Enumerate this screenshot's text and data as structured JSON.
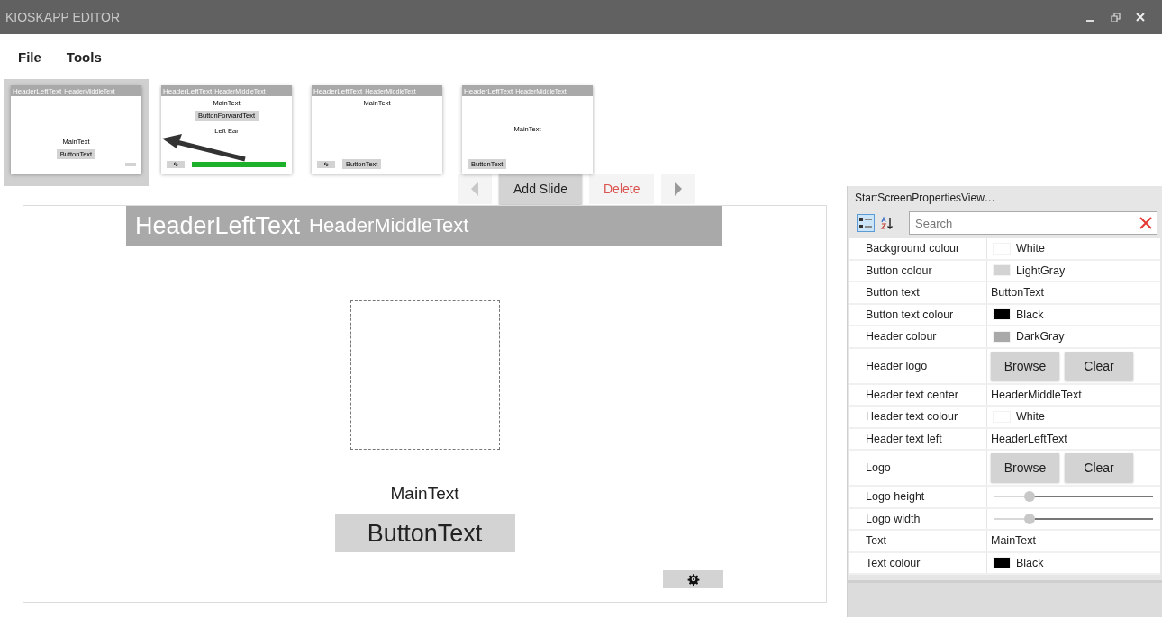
{
  "window": {
    "title": "KIOSKAPP EDITOR"
  },
  "menu": [
    "File",
    "Tools"
  ],
  "slides": [
    {
      "selected": true,
      "header_left": "HeaderLeftText",
      "header_middle": "HeaderMiddleText",
      "bottom": [
        {
          "kind": "text",
          "text": "MainText"
        },
        {
          "kind": "button",
          "text": "ButtonText"
        }
      ],
      "footer": [
        {
          "kind": "settings"
        }
      ]
    },
    {
      "selected": false,
      "header_left": "HeaderLeftText",
      "header_middle": "HeaderMiddleText",
      "top": [
        {
          "kind": "text",
          "text": "MainText"
        },
        {
          "kind": "button",
          "text": "ButtonForwardText"
        },
        {
          "kind": "text",
          "text": "Left Ear"
        }
      ],
      "footer": [
        {
          "kind": "back"
        },
        {
          "kind": "progress",
          "level": 1
        }
      ]
    },
    {
      "selected": false,
      "header_left": "HeaderLeftText",
      "header_middle": "HeaderMiddleText",
      "top": [
        {
          "kind": "text",
          "text": "MainText"
        }
      ],
      "footer": [
        {
          "kind": "back"
        },
        {
          "kind": "button",
          "text": "ButtonText"
        }
      ]
    },
    {
      "selected": false,
      "header_left": "HeaderLeftText",
      "header_middle": "HeaderMiddleText",
      "middle": [
        {
          "kind": "text",
          "text": "MainText"
        }
      ],
      "footer": [
        {
          "kind": "button",
          "text": "ButtonText"
        }
      ]
    }
  ],
  "slide_toolbar": [
    {
      "kind": "prev",
      "disabled": true
    },
    {
      "kind": "button",
      "label": "Add Slide",
      "disabled": false
    },
    {
      "kind": "button",
      "label": "Delete",
      "disabled": true
    },
    {
      "kind": "next",
      "disabled": false
    }
  ],
  "editor": {
    "header_left": "HeaderLeftText",
    "header_middle": "HeaderMiddleText",
    "main_text": "MainText",
    "button_text": "ButtonText"
  },
  "properties": {
    "title": "StartScreenPropertiesView…",
    "view_modes": [
      {
        "kind": "categorized",
        "selected": true
      },
      {
        "kind": "alphabetical",
        "selected": false
      }
    ],
    "search": {
      "placeholder": "Search"
    },
    "rows": [
      {
        "name": "Background colour",
        "kind": "color",
        "value": "White",
        "color": "#ffffff"
      },
      {
        "name": "Button colour",
        "kind": "color",
        "value": "LightGray",
        "color": "#d3d3d3"
      },
      {
        "name": "Button text",
        "kind": "text",
        "value": "ButtonText"
      },
      {
        "name": "Button text colour",
        "kind": "color",
        "value": "Black",
        "color": "#000000"
      },
      {
        "name": "Header colour",
        "kind": "color",
        "value": "DarkGray",
        "color": "#a9a9a9"
      },
      {
        "name": "Header logo",
        "kind": "buttons",
        "buttons": [
          "Browse",
          "Clear"
        ]
      },
      {
        "name": "Header text center",
        "kind": "text",
        "value": "HeaderMiddleText"
      },
      {
        "name": "Header text colour",
        "kind": "color",
        "value": "White",
        "color": "#ffffff"
      },
      {
        "name": "Header text left",
        "kind": "text",
        "value": "HeaderLeftText"
      },
      {
        "name": "Logo",
        "kind": "buttons",
        "buttons": [
          "Browse",
          "Clear"
        ]
      },
      {
        "name": "Logo height",
        "kind": "slider",
        "level": 0.2
      },
      {
        "name": "Logo width",
        "kind": "slider",
        "level": 0.2
      },
      {
        "name": "Text",
        "kind": "text",
        "value": "MainText"
      },
      {
        "name": "Text colour",
        "kind": "color",
        "value": "Black",
        "color": "#000000"
      }
    ]
  }
}
